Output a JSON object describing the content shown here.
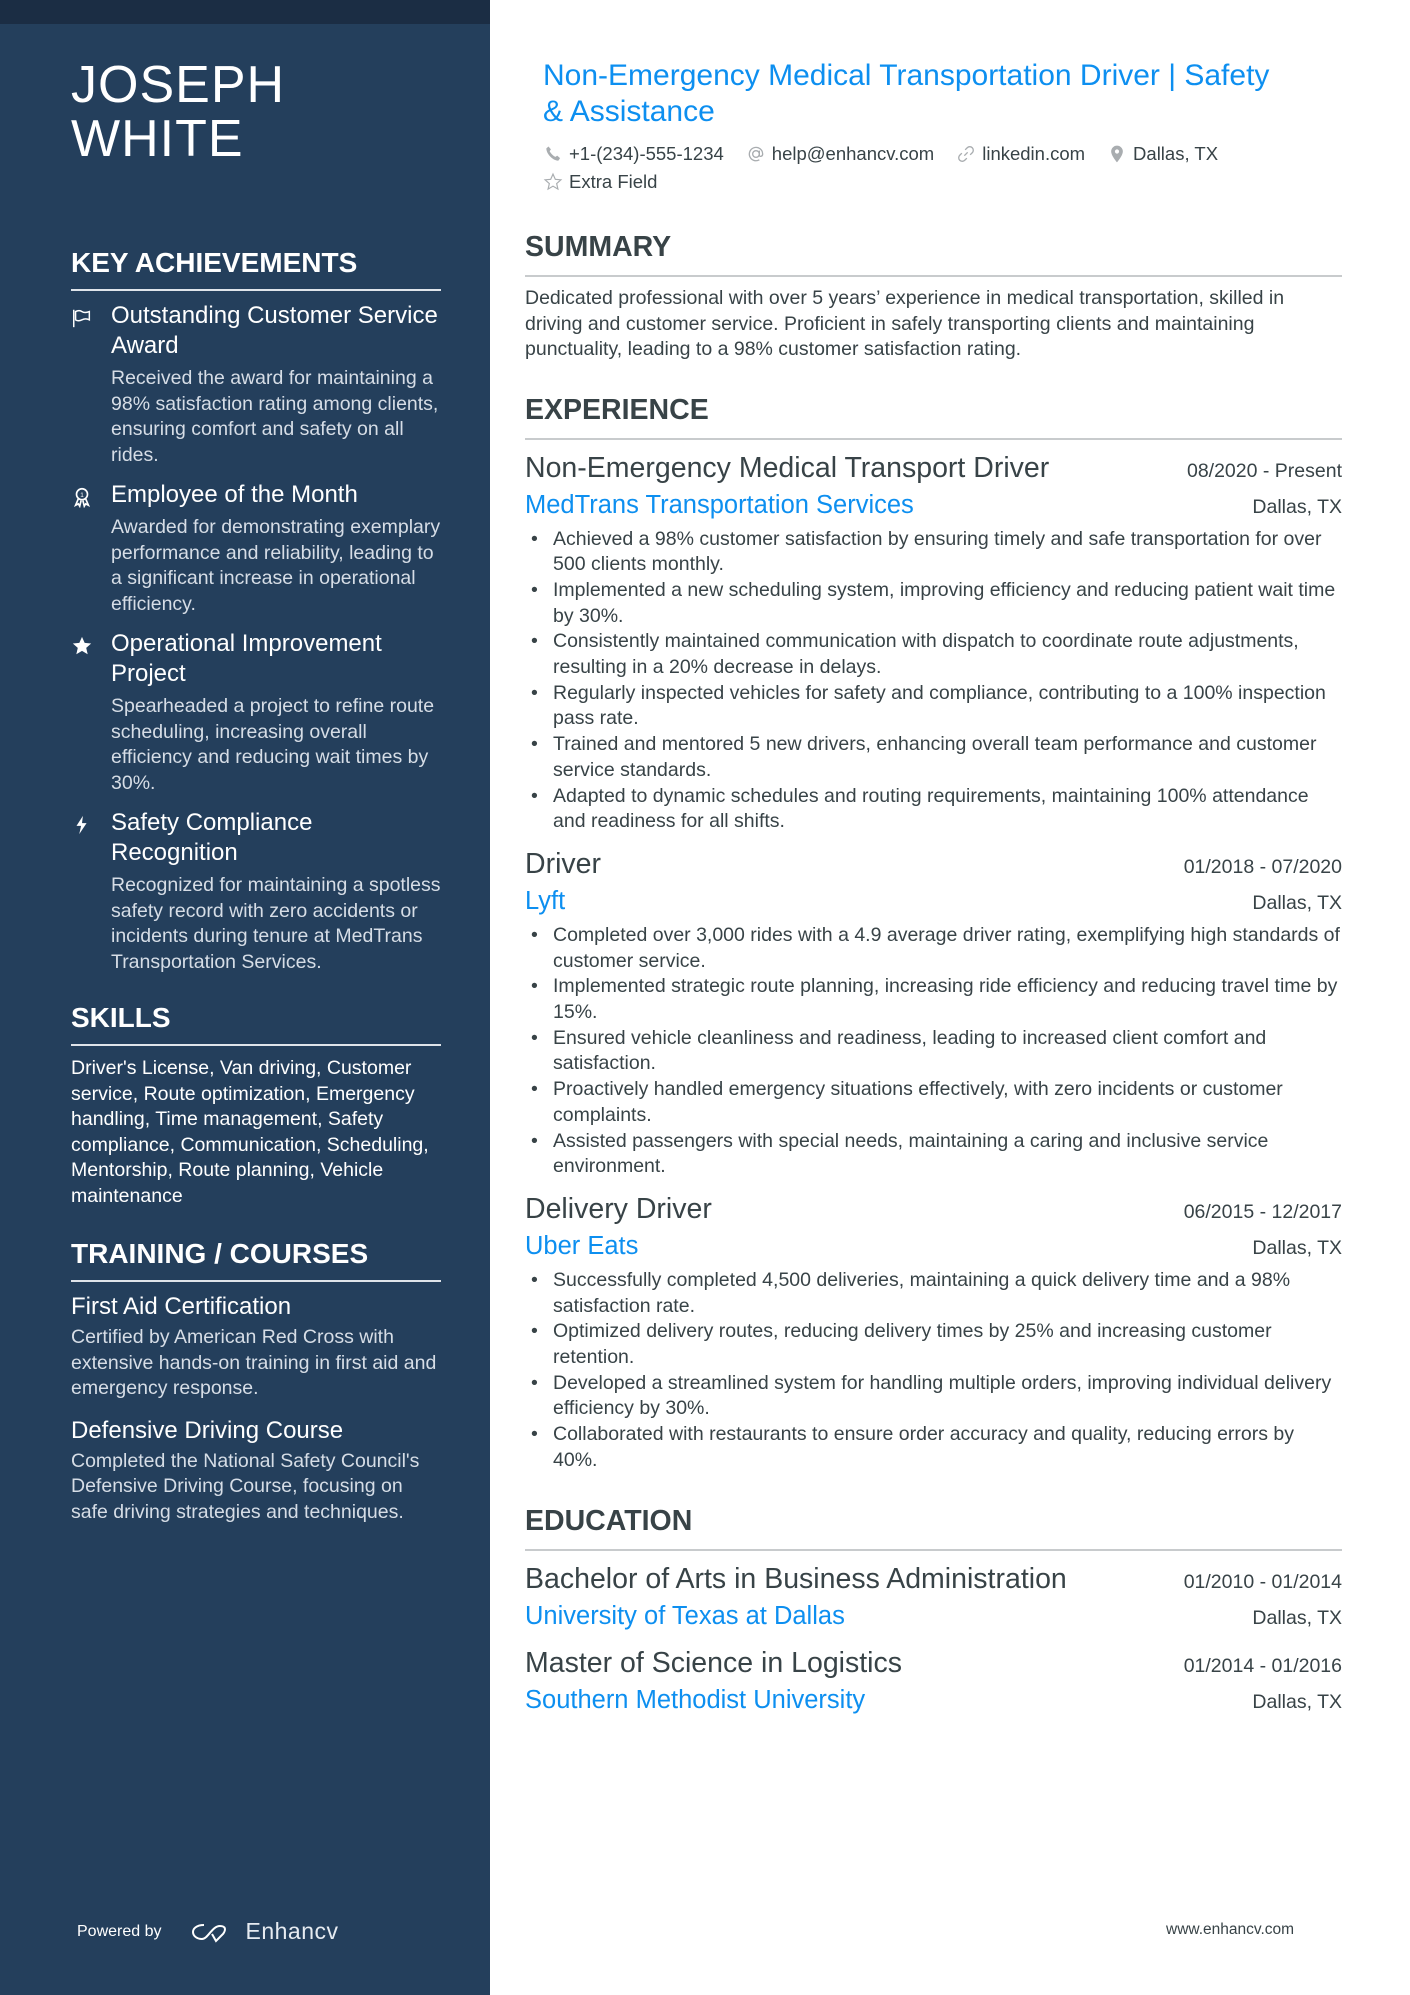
{
  "header": {
    "name": "JOSEPH WHITE",
    "title": "Non-Emergency Medical Transportation Driver | Safety & Assistance",
    "contacts": [
      {
        "icon": "phone-icon",
        "text": "+1-(234)-555-1234"
      },
      {
        "icon": "at-icon",
        "text": "help@enhancv.com"
      },
      {
        "icon": "link-icon",
        "text": "linkedin.com"
      },
      {
        "icon": "location-pin-icon",
        "text": "Dallas, TX"
      },
      {
        "icon": "star-outline-icon",
        "text": "Extra Field"
      }
    ]
  },
  "sidebar": {
    "achievements": {
      "heading": "KEY ACHIEVEMENTS",
      "items": [
        {
          "icon": "flag-icon",
          "title": "Outstanding Customer Service Award",
          "desc": "Received the award for maintaining a 98% satisfaction rating among clients, ensuring comfort and safety on all rides."
        },
        {
          "icon": "award-ribbon-icon",
          "title": "Employee of the Month",
          "desc": "Awarded for demonstrating exemplary performance and reliability, leading to a significant increase in operational efficiency."
        },
        {
          "icon": "star-icon",
          "title": "Operational Improvement Project",
          "desc": "Spearheaded a project to refine route scheduling, increasing overall efficiency and reducing wait times by 30%."
        },
        {
          "icon": "lightning-bolt-icon",
          "title": "Safety Compliance Recognition",
          "desc": "Recognized for maintaining a spotless safety record with zero accidents or incidents during tenure at MedTrans Transportation Services."
        }
      ]
    },
    "skills": {
      "heading": "SKILLS",
      "text": "Driver's License, Van driving, Customer service, Route optimization, Emergency handling, Time management, Safety compliance, Communication, Scheduling, Mentorship, Route planning, Vehicle maintenance"
    },
    "training": {
      "heading": "TRAINING / COURSES",
      "items": [
        {
          "title": "First Aid Certification",
          "desc": "Certified by American Red Cross with extensive hands-on training in first aid and emergency response."
        },
        {
          "title": "Defensive Driving Course",
          "desc": "Completed the National Safety Council's Defensive Driving Course, focusing on safe driving strategies and techniques."
        }
      ]
    },
    "footer": {
      "powered_by": "Powered by",
      "brand": "Enhancv"
    }
  },
  "main": {
    "summary": {
      "heading": "SUMMARY",
      "text": "Dedicated professional with over 5 years’ experience in medical transportation, skilled in driving and customer service. Proficient in safely transporting clients and maintaining punctuality, leading to a 98% customer satisfaction rating."
    },
    "experience": {
      "heading": "EXPERIENCE",
      "items": [
        {
          "title": "Non-Emergency Medical Transport Driver",
          "dates": "08/2020 - Present",
          "company": "MedTrans Transportation Services",
          "location": "Dallas, TX",
          "bullets": [
            "Achieved a 98% customer satisfaction by ensuring timely and safe transportation for over 500 clients monthly.",
            "Implemented a new scheduling system, improving efficiency and reducing patient wait time by 30%.",
            "Consistently maintained communication with dispatch to coordinate route adjustments, resulting in a 20% decrease in delays.",
            "Regularly inspected vehicles for safety and compliance, contributing to a 100% inspection pass rate.",
            "Trained and mentored 5 new drivers, enhancing overall team performance and customer service standards.",
            "Adapted to dynamic schedules and routing requirements, maintaining 100% attendance and readiness for all shifts."
          ]
        },
        {
          "title": "Driver",
          "dates": "01/2018 - 07/2020",
          "company": "Lyft",
          "location": "Dallas, TX",
          "bullets": [
            "Completed over 3,000 rides with a 4.9 average driver rating, exemplifying high standards of customer service.",
            "Implemented strategic route planning, increasing ride efficiency and reducing travel time by 15%.",
            "Ensured vehicle cleanliness and readiness, leading to increased client comfort and satisfaction.",
            "Proactively handled emergency situations effectively, with zero incidents or customer complaints.",
            "Assisted passengers with special needs, maintaining a caring and inclusive service environment."
          ]
        },
        {
          "title": "Delivery Driver",
          "dates": "06/2015 - 12/2017",
          "company": "Uber Eats",
          "location": "Dallas, TX",
          "bullets": [
            "Successfully completed 4,500 deliveries, maintaining a quick delivery time and a 98% satisfaction rate.",
            "Optimized delivery routes, reducing delivery times by 25% and increasing customer retention.",
            "Developed a streamlined system for handling multiple orders, improving individual delivery efficiency by 30%.",
            "Collaborated with restaurants to ensure order accuracy and quality, reducing errors by 40%."
          ]
        }
      ]
    },
    "education": {
      "heading": "EDUCATION",
      "items": [
        {
          "degree": "Bachelor of Arts in Business Administration",
          "dates": "01/2010 - 01/2014",
          "school": "University of Texas at Dallas",
          "location": "Dallas, TX"
        },
        {
          "degree": "Master of Science in Logistics",
          "dates": "01/2014 - 01/2016",
          "school": "Southern Methodist University",
          "location": "Dallas, TX"
        }
      ]
    },
    "footer_url": "www.enhancv.com"
  },
  "colors": {
    "sidebar_bg": "#243f5c",
    "sidebar_topband": "#1b2d44",
    "accent": "#0d8ff0",
    "text": "#384347"
  }
}
